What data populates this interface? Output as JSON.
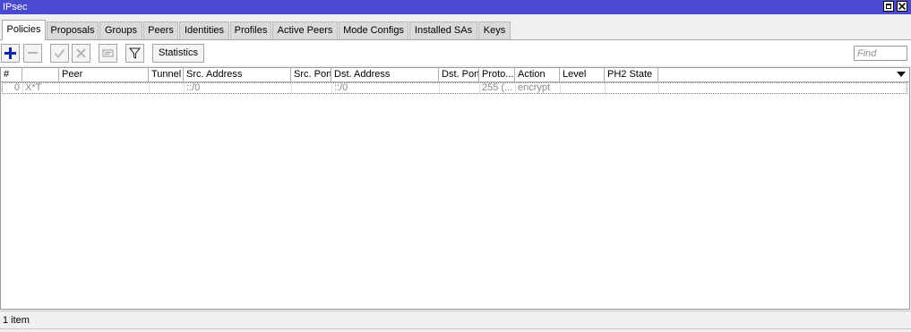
{
  "window": {
    "title": "IPsec"
  },
  "tabs": [
    {
      "label": "Policies",
      "active": true
    },
    {
      "label": "Proposals"
    },
    {
      "label": "Groups"
    },
    {
      "label": "Peers"
    },
    {
      "label": "Identities"
    },
    {
      "label": "Profiles"
    },
    {
      "label": "Active Peers"
    },
    {
      "label": "Mode Configs"
    },
    {
      "label": "Installed SAs"
    },
    {
      "label": "Keys"
    }
  ],
  "toolbar": {
    "add_icon": "plus-icon",
    "remove_icon": "minus-icon",
    "enable_icon": "check-icon",
    "disable_icon": "x-icon",
    "comment_icon": "comment-icon",
    "filter_icon": "filter-icon",
    "statistics_label": "Statistics",
    "find_placeholder": "Find",
    "add_color": "#0b27a8"
  },
  "table": {
    "columns": [
      "#",
      "",
      "Peer",
      "Tunnel",
      "Src. Address",
      "Src. Port",
      "Dst. Address",
      "Dst. Port",
      "Proto...",
      "Action",
      "Level",
      "PH2 State"
    ],
    "rows": [
      {
        "num": "0",
        "flags": "X*T",
        "peer": "",
        "tunnel": "",
        "src_address": "::/0",
        "src_port": "",
        "dst_address": "::/0",
        "dst_port": "",
        "protocol": "255 (...",
        "action": "encrypt",
        "level": "",
        "ph2_state": ""
      }
    ]
  },
  "status": {
    "text": "1 item"
  }
}
